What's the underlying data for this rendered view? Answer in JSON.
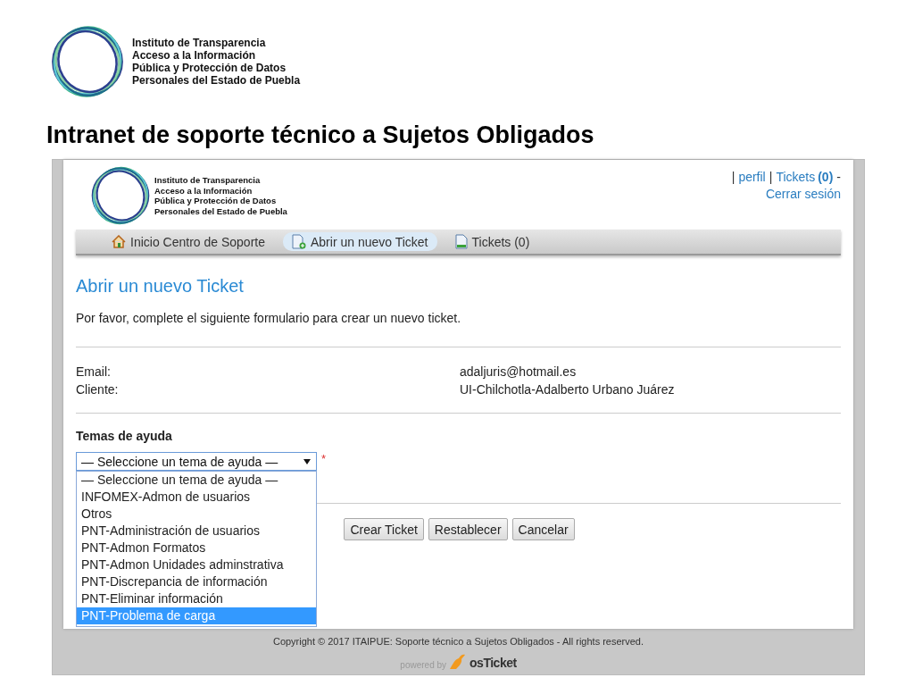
{
  "slide": {
    "org_lines": [
      "Instituto de Transparencia",
      "Acceso a la Información",
      "Pública y Protección de Datos",
      "Personales del Estado de Puebla"
    ],
    "title": "Intranet de soporte técnico a Sujetos Obligados"
  },
  "site": {
    "org_lines": [
      "Instituto de Transparencia",
      "Acceso a la Información",
      "Pública y Protección de Datos",
      "Personales del Estado de Puebla"
    ],
    "account_nav": [
      [
        {
          "kind": "text",
          "text": "|"
        },
        {
          "kind": "link",
          "text": "perfil"
        },
        {
          "kind": "text",
          "text": "|"
        },
        {
          "kind": "link",
          "text": "Tickets"
        },
        {
          "kind": "count",
          "text": "(0)"
        },
        {
          "kind": "text",
          "text": "-"
        }
      ],
      [
        {
          "kind": "link",
          "text": "Cerrar sesión"
        }
      ]
    ],
    "nav_tabs": [
      {
        "kind": "home",
        "label": "Inicio Centro de Soporte",
        "selected": false
      },
      {
        "kind": "new",
        "label": "Abrir un nuevo Ticket",
        "selected": true
      },
      {
        "kind": "list",
        "label": "Tickets (0)",
        "selected": false
      }
    ]
  },
  "form": {
    "heading": "Abrir un nuevo Ticket",
    "intro": "Por favor, complete el siguiente formulario para crear un nuevo ticket.",
    "info_rows": [
      {
        "label": "Email:",
        "value": "adaljuris@hotmail.es"
      },
      {
        "label": "Cliente:",
        "value": "UI-Chilchotla-Adalberto Urbano Juárez"
      }
    ],
    "help_topic": {
      "label": "Temas de ayuda",
      "value": "— Seleccione un tema de ayuda —",
      "required_mark": "*",
      "expanded": true,
      "options": [
        {
          "label": "— Seleccione un tema de ayuda —",
          "highlighted": false
        },
        {
          "label": "INFOMEX-Admon de usuarios",
          "highlighted": false
        },
        {
          "label": "Otros",
          "highlighted": false
        },
        {
          "label": "PNT-Administración de usuarios",
          "highlighted": false
        },
        {
          "label": "PNT-Admon Formatos",
          "highlighted": false
        },
        {
          "label": "PNT-Admon Unidades adminstrativa",
          "highlighted": false
        },
        {
          "label": "PNT-Discrepancia de información",
          "highlighted": false
        },
        {
          "label": "PNT-Eliminar información",
          "highlighted": false
        },
        {
          "label": "PNT-Problema de carga",
          "highlighted": true
        }
      ]
    },
    "buttons": [
      "Crear Ticket",
      "Restablecer",
      "Cancelar"
    ]
  },
  "footer": {
    "copyright": "Copyright © 2017 ITAIPUE: Soporte técnico a Sujetos Obligados - All rights reserved.",
    "powered_by": "powered by",
    "brand": "osTicket"
  }
}
